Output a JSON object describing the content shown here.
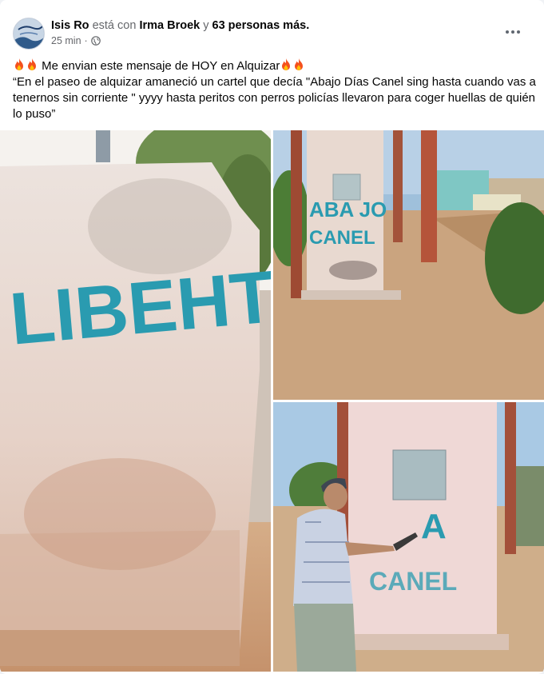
{
  "post": {
    "author": "Isis Ro",
    "with_text": "está con",
    "tagged": "Irma Broek",
    "and_text": "y",
    "others": "63 personas más.",
    "time": "25 min",
    "dot": "·",
    "privacy_icon": "globe-icon",
    "line1": "Me envian este mensaje de HOY en Alquizar",
    "quote": "“En el paseo de alquizar amaneció un cartel que decía \"Abajo Días Canel sing hasta cuando vas a tenernos sin corriente \" yyyy hasta peritos con perros policías llevaron para coger huellas de quién lo puso”",
    "emoji_icon": "fire-emoji"
  },
  "photos": {
    "p1_graffiti": "LIBEHTA",
    "p2_graffiti_line1": "ABA JO",
    "p2_graffiti_line2": "CANEL",
    "p3_graffiti_line1": "A",
    "p3_graffiti_line2": "CANEL"
  },
  "colors": {
    "graffiti": "#2a9bb0",
    "wall": "#e8d9d0",
    "ground": "#c9a27e",
    "pillar": "#b5543a"
  }
}
